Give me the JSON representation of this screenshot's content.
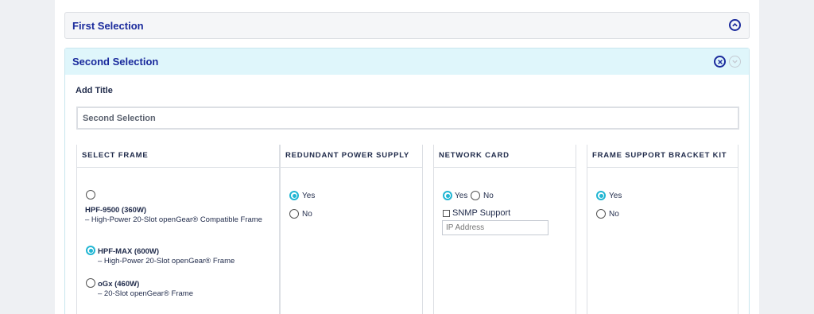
{
  "panels": {
    "first": {
      "title": "First Selection"
    },
    "second": {
      "title": "Second Selection",
      "add_title_label": "Add Title",
      "title_input_value": "Second Selection"
    }
  },
  "columns": {
    "frame": {
      "title": "SELECT FRAME",
      "options": [
        {
          "name": "HPF-9500 (360W)",
          "desc": "– High-Power 20-Slot openGear® Compatible Frame",
          "selected": false
        },
        {
          "name": "HPF-MAX (600W)",
          "desc": "– High-Power 20-Slot openGear® Frame",
          "selected": true
        },
        {
          "name": "oGx (460W)",
          "desc": "– 20-Slot openGear® Frame",
          "selected": false
        }
      ]
    },
    "power": {
      "title": "REDUNDANT POWER SUPPLY",
      "yes": "Yes",
      "no": "No",
      "selected": "Yes"
    },
    "network": {
      "title": "NETWORK CARD",
      "yes": "Yes",
      "no": "No",
      "selected": "Yes",
      "snmp_label": "SNMP Support",
      "ip_placeholder": "IP Address"
    },
    "bracket": {
      "title": "FRAME SUPPORT BRACKET KIT",
      "yes": "Yes",
      "no": "No",
      "selected": "Yes"
    }
  },
  "icons": {
    "collapse": "chevron-up-circle-icon",
    "remove": "close-circle-icon",
    "expand": "chevron-down-circle-icon"
  },
  "colors": {
    "accent": "#1a2a9c",
    "radio_selected": "#21b6d3",
    "second_header_bg": "#dff6fb"
  }
}
